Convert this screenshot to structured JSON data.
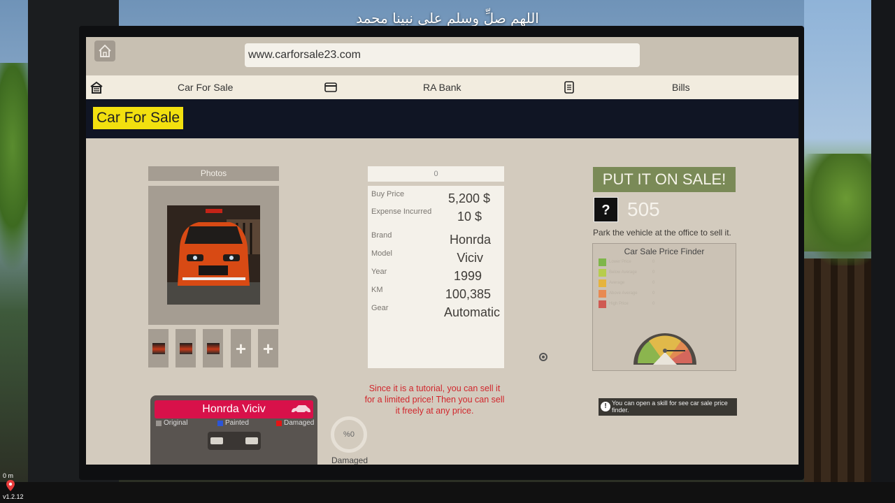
{
  "overlay_title": "اللهم صلِّ وسلم على نبينا محمد",
  "browser": {
    "url": "www.carforsale23.com"
  },
  "nav": {
    "items": [
      {
        "label": "Car For Sale",
        "icon": "garage-icon"
      },
      {
        "label": "RA Bank",
        "icon": "credit-card-icon"
      },
      {
        "label": "Bills",
        "icon": "bill-icon"
      }
    ]
  },
  "section": {
    "title": "Car For Sale"
  },
  "photos": {
    "header": "Photos",
    "thumb_add_symbol": "+"
  },
  "details": {
    "price_input_value": "0",
    "rows": [
      {
        "label": "Buy Price",
        "value": "5,200 $"
      },
      {
        "label": "Expense Incurred",
        "value": "10 $"
      },
      {
        "label": "Brand",
        "value": "Honrda"
      },
      {
        "label": "Model",
        "value": "Viciv"
      },
      {
        "label": "Year",
        "value": "1999"
      },
      {
        "label": "KM",
        "value": "100,385"
      },
      {
        "label": "Gear",
        "value": "Automatic"
      }
    ],
    "tutorial_note": "Since it is a tutorial, you can sell it for a limited price! Then you can sell it freely at any price."
  },
  "sale": {
    "button_label": "PUT IT ON SALE!",
    "unknown_symbol": "?",
    "price_display": "505",
    "park_note": "Park the vehicle at the office to sell it.",
    "finder_title": "Car Sale Price Finder",
    "finder_legend": [
      {
        "label": "Lower Price",
        "value": "0",
        "color": "#7fb64a"
      },
      {
        "label": "Below Average",
        "value": "0",
        "color": "#b7cd4c"
      },
      {
        "label": "Average",
        "value": "0",
        "color": "#e6b43c"
      },
      {
        "label": "Above Average",
        "value": "0",
        "color": "#e88a52"
      },
      {
        "label": "High Price",
        "value": "0",
        "color": "#cf5a52"
      }
    ],
    "skill_note": "You can open a skill for see car sale price finder."
  },
  "car_card": {
    "title": "Honrda Viciv",
    "legend": [
      {
        "label": "Original",
        "color": "#9a9590"
      },
      {
        "label": "Painted",
        "color": "#2b55d8"
      },
      {
        "label": "Damaged",
        "color": "#e31515"
      }
    ]
  },
  "damage": {
    "percent": "%0",
    "label": "Damaged"
  },
  "hud": {
    "distance": "0 m",
    "version": "v1.2.12"
  }
}
